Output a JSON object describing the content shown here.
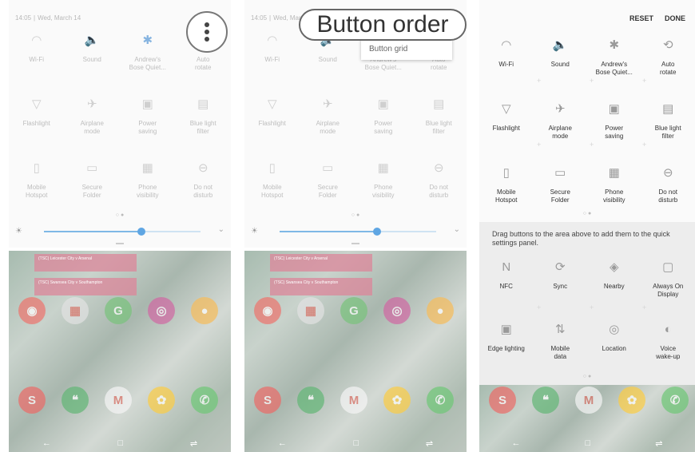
{
  "status": {
    "time": "14:05",
    "separator": "|",
    "date": "Wed, March 14"
  },
  "tiles": [
    {
      "label": "Wi-Fi",
      "icon": "wifi-icon",
      "glyph": "◠",
      "on": false
    },
    {
      "label": "Sound",
      "icon": "sound-icon",
      "glyph": "🔈",
      "on": true
    },
    {
      "label": "Andrew's\nBose Quiet...",
      "icon": "bluetooth-icon",
      "glyph": "✱",
      "on": true
    },
    {
      "label": "Auto\nrotate",
      "icon": "auto-rotate-icon",
      "glyph": "⟲",
      "on": false
    },
    {
      "label": "Flashlight",
      "icon": "flashlight-icon",
      "glyph": "▽",
      "on": false
    },
    {
      "label": "Airplane\nmode",
      "icon": "airplane-icon",
      "glyph": "✈",
      "on": false
    },
    {
      "label": "Power\nsaving",
      "icon": "power-saving-icon",
      "glyph": "▣",
      "on": false
    },
    {
      "label": "Blue light\nfilter",
      "icon": "blue-light-filter-icon",
      "glyph": "▤",
      "on": false
    },
    {
      "label": "Mobile\nHotspot",
      "icon": "mobile-hotspot-icon",
      "glyph": "▯",
      "on": false
    },
    {
      "label": "Secure\nFolder",
      "icon": "secure-folder-icon",
      "glyph": "▭",
      "on": false
    },
    {
      "label": "Phone\nvisibility",
      "icon": "phone-visibility-icon",
      "glyph": "▦",
      "on": false
    },
    {
      "label": "Do not\ndisturb",
      "icon": "do-not-disturb-icon",
      "glyph": "⊖",
      "on": false
    }
  ],
  "page_dots": "○ ●",
  "brightness": {
    "level": 0.62
  },
  "menu": {
    "items": [
      "Button grid"
    ]
  },
  "callout": "Button order",
  "edit": {
    "reset": "RESET",
    "done": "DONE"
  },
  "available": {
    "hint": "Drag buttons to the area above to add them to the quick settings panel.",
    "tiles": [
      {
        "label": "NFC",
        "icon": "nfc-icon",
        "glyph": "N"
      },
      {
        "label": "Sync",
        "icon": "sync-icon",
        "glyph": "⟳"
      },
      {
        "label": "Nearby",
        "icon": "nearby-icon",
        "glyph": "◈"
      },
      {
        "label": "Always On\nDisplay",
        "icon": "always-on-display-icon",
        "glyph": "▢"
      },
      {
        "label": "Edge lighting",
        "icon": "edge-lighting-icon",
        "glyph": "▣"
      },
      {
        "label": "Mobile\ndata",
        "icon": "mobile-data-icon",
        "glyph": "⇅"
      },
      {
        "label": "Location",
        "icon": "location-icon",
        "glyph": "◎"
      },
      {
        "label": "Voice\nwake-up",
        "icon": "voice-wakeup-icon",
        "glyph": "◐"
      }
    ]
  },
  "home": {
    "news": [
      "(TSC) Leicester City v Arsenal",
      "(TSC) Swansea City v Southampton"
    ],
    "apps": [
      {
        "icon": "app-icon-red",
        "color": "#e8453c",
        "glyph": "◉"
      },
      {
        "icon": "app-icon-folder",
        "color": "#d9d9d9",
        "glyph": "▦"
      },
      {
        "icon": "maps-icon",
        "color": "#4caf50",
        "glyph": "G"
      },
      {
        "icon": "instagram-icon",
        "color": "#c13584",
        "glyph": "◎"
      },
      {
        "icon": "app-icon-orange",
        "color": "#f5a623",
        "glyph": "●"
      },
      {
        "icon": "app-icon-s",
        "color": "#e53935",
        "glyph": "S"
      },
      {
        "icon": "hangouts-icon",
        "color": "#2e9e48",
        "glyph": "❝"
      },
      {
        "icon": "gmail-icon",
        "color": "#f2f2f2",
        "glyph": "M"
      },
      {
        "icon": "photos-icon",
        "color": "#fbbc05",
        "glyph": "✿"
      },
      {
        "icon": "phone-icon",
        "color": "#3eb549",
        "glyph": "✆"
      }
    ]
  },
  "nav": {
    "back": "←",
    "home": "□",
    "recents": "⇌"
  },
  "colors": {
    "accent": "#5fa6e3",
    "callout_border": "#666666"
  }
}
